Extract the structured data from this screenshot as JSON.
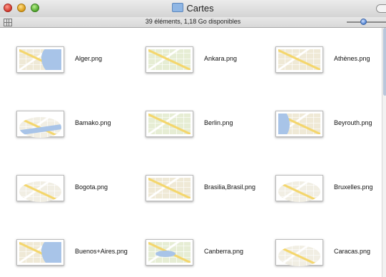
{
  "window": {
    "title": "Cartes",
    "status": "39 éléments, 1,18 Go disponibles"
  },
  "icons": {
    "folder": "folder-icon",
    "view": "icon-view-icon",
    "file": "png-thumbnail-icon"
  },
  "items": [
    {
      "name": "Alger.png"
    },
    {
      "name": "Ankara.png"
    },
    {
      "name": "Athènes.png"
    },
    {
      "name": "Bamako.png"
    },
    {
      "name": "Berlin.png"
    },
    {
      "name": "Beyrouth.png"
    },
    {
      "name": "Bogota.png"
    },
    {
      "name": "Brasilia,Brasil.png"
    },
    {
      "name": "Bruxelles.png"
    },
    {
      "name": "Buenos+Aires.png"
    },
    {
      "name": "Canberra.png"
    },
    {
      "name": "Caracas.png"
    }
  ]
}
